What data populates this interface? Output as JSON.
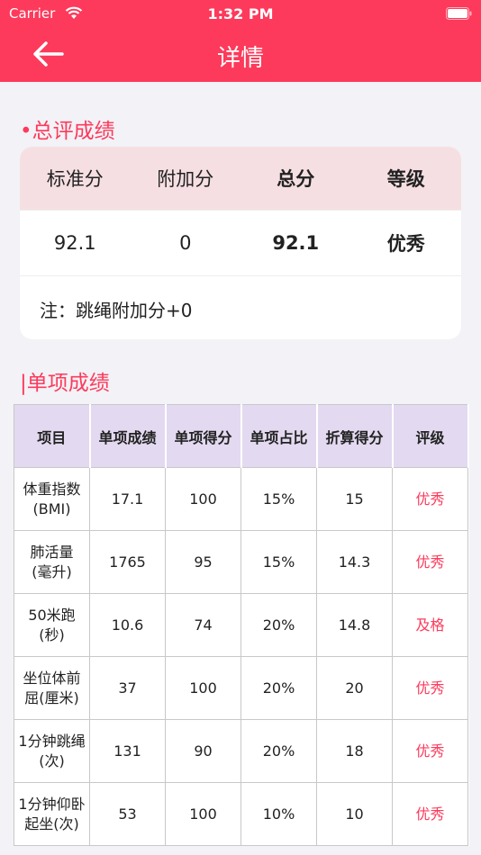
{
  "status": {
    "carrier": "Carrier",
    "time": "1:32 PM"
  },
  "nav": {
    "title": "详情"
  },
  "summary": {
    "title": "•总评成绩",
    "headers": [
      "标准分",
      "附加分",
      "总分",
      "等级"
    ],
    "values": [
      "92.1",
      "0",
      "92.1",
      "优秀"
    ],
    "note": "注：跳绳附加分+0"
  },
  "items": {
    "title": "|单项成绩",
    "headers": [
      "项目",
      "单项成绩",
      "单项得分",
      "单项占比",
      "折算得分",
      "评级"
    ],
    "rows": [
      {
        "name": "体重指数\n(BMI)",
        "score": "17.1",
        "points": "100",
        "ratio": "15%",
        "converted": "15",
        "rating": "优秀"
      },
      {
        "name": "肺活量\n(毫升)",
        "score": "1765",
        "points": "95",
        "ratio": "15%",
        "converted": "14.3",
        "rating": "优秀"
      },
      {
        "name": "50米跑\n(秒)",
        "score": "10.6",
        "points": "74",
        "ratio": "20%",
        "converted": "14.8",
        "rating": "及格"
      },
      {
        "name": "坐位体前\n屈(厘米)",
        "score": "37",
        "points": "100",
        "ratio": "20%",
        "converted": "20",
        "rating": "优秀"
      },
      {
        "name": "1分钟跳绳\n(次)",
        "score": "131",
        "points": "90",
        "ratio": "20%",
        "converted": "18",
        "rating": "优秀"
      },
      {
        "name": "1分钟仰卧\n起坐(次)",
        "score": "53",
        "points": "100",
        "ratio": "10%",
        "converted": "10",
        "rating": "优秀"
      }
    ]
  },
  "colors": {
    "accent": "#fd3a5b",
    "summary_header": "#f6dfe2",
    "table_header": "#e3d9f0"
  },
  "icons": {
    "back": "arrow-left-icon",
    "wifi": "wifi-icon",
    "battery": "battery-icon"
  }
}
